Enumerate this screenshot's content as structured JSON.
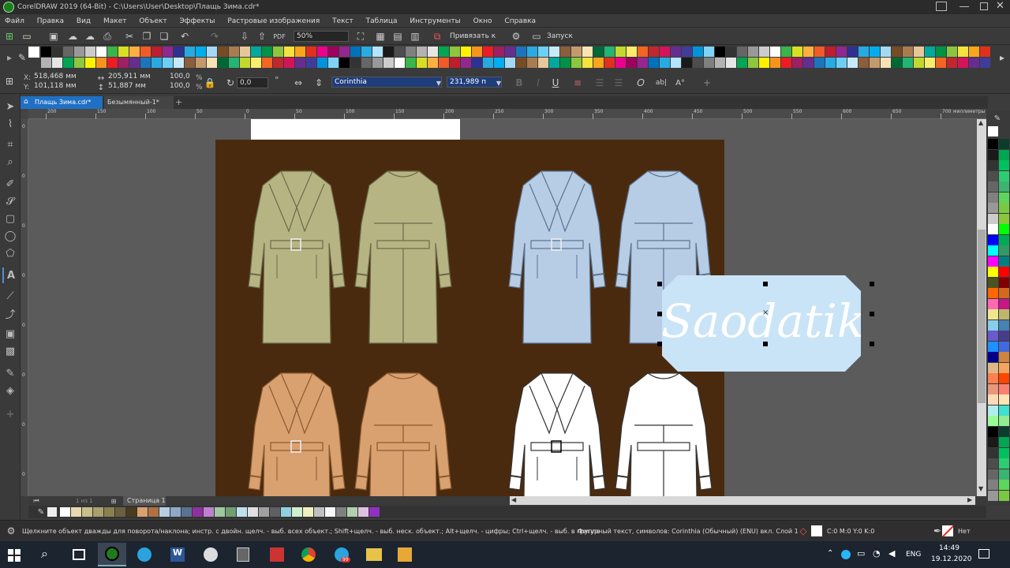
{
  "window": {
    "title": "CorelDRAW 2019 (64-Bit) - C:\\Users\\User\\Desktop\\Плащь Зима.cdr*"
  },
  "menu": [
    "Файл",
    "Правка",
    "Вид",
    "Макет",
    "Объект",
    "Эффекты",
    "Растровые изображения",
    "Текст",
    "Таблица",
    "Инструменты",
    "Окно",
    "Справка"
  ],
  "toolbar": {
    "zoom": "50%",
    "snap_label": "Привязать к",
    "launch_label": "Запуск"
  },
  "props": {
    "x_label": "X:",
    "x": "518,468 мм",
    "y_label": "Y:",
    "y": "101,118 мм",
    "w": "205,911 мм",
    "h": "51,887 мм",
    "scale_w": "100,0",
    "scale_h": "100,0",
    "pct": "%",
    "angle": "0,0",
    "deg": "°",
    "font": "Corinthia",
    "font_size": "231,989 п"
  },
  "tabs": [
    {
      "label": "Плащь Зима.cdr*",
      "active": true
    },
    {
      "label": "Безымянный-1*",
      "active": false
    }
  ],
  "ruler": {
    "ticks": [
      "200",
      "150",
      "100",
      "50",
      "0",
      "50",
      "100",
      "150",
      "200",
      "250",
      "300",
      "350",
      "400",
      "450",
      "500",
      "550",
      "600",
      "650",
      "700"
    ],
    "unit": "миллиметры"
  },
  "vruler": {
    "ticks": [
      "0",
      "0",
      "0",
      "0",
      "0",
      "0",
      "0",
      "0"
    ]
  },
  "canvas": {
    "artboard_color": "#4a2a0e",
    "selected_text": "Saodatik",
    "label_color": "#c9e4f7",
    "coats": [
      {
        "fill": "#b7b484",
        "stroke": "#6a6a48",
        "view": "front"
      },
      {
        "fill": "#b7b484",
        "stroke": "#6a6a48",
        "view": "back"
      },
      {
        "fill": "#b7cde6",
        "stroke": "#5b7290",
        "view": "front"
      },
      {
        "fill": "#b7cde6",
        "stroke": "#5b7290",
        "view": "back"
      },
      {
        "fill": "#d9a070",
        "stroke": "#8a5a30",
        "view": "front"
      },
      {
        "fill": "#d9a070",
        "stroke": "#8a5a30",
        "view": "back"
      },
      {
        "fill": "#ffffff",
        "stroke": "#333333",
        "view": "front"
      },
      {
        "fill": "#ffffff",
        "stroke": "#333333",
        "view": "back"
      }
    ]
  },
  "page_nav": {
    "counter": "1 из 1",
    "page_tab": "Страница 1"
  },
  "status": {
    "hint": "Щелкните объект дважды для поворота/наклона; инстр. с двойн. щелч. - выб. всех объект.; Shift+щелч. - выб. неск. объект.; Alt+щелч. - цифры; Ctrl+щелч. - выб. в группе",
    "info": "Фигурный текст, символов: Corinthia (Обычный) (ENU) вкл. Слой 1",
    "fill_info": "C:0 M:0 Y:0 K:0",
    "outline_label": "Нет"
  },
  "taskbar": {
    "lang": "ENG",
    "time": "14:49",
    "date": "19.12.2020",
    "badge": "99"
  },
  "palette_colors": [
    "#000000",
    "#1a1a1a",
    "#333333",
    "#4d4d4d",
    "#666666",
    "#808080",
    "#999999",
    "#b3b3b3",
    "#cccccc",
    "#e6e6e6",
    "#ffffff",
    "#00a651",
    "#39b54a",
    "#8dc63f",
    "#d7df23",
    "#fff200",
    "#fbb040",
    "#f7941d",
    "#f15a29",
    "#ed1c24",
    "#be1e2d",
    "#9e1f63",
    "#92278f",
    "#662d91",
    "#2e3192",
    "#1c75bc",
    "#27aae1",
    "#29abe2",
    "#00aeef",
    "#6dcff6",
    "#a3d9f5",
    "#c7eafb",
    "#754c24",
    "#8b5e3c",
    "#a97c50",
    "#c49a6c",
    "#e6c79a",
    "#f9e3b4",
    "#00a99d",
    "#006837",
    "#009245",
    "#22b573",
    "#8cc63f",
    "#c2d82e",
    "#f4e23f",
    "#f9ed6b",
    "#faa61a",
    "#f26522",
    "#e0301e",
    "#c1272d",
    "#ec008c",
    "#d4145a",
    "#9e005d",
    "#662d91",
    "#93278f",
    "#3f3d99",
    "#0071bc",
    "#0093dd",
    "#29abe2",
    "#7fd3f7",
    "#b3e5fc"
  ],
  "right_palette": [
    "#000000",
    "#0b3d2e",
    "#1a1a1a",
    "#00a651",
    "#333333",
    "#00c060",
    "#4d4d4d",
    "#2ecc71",
    "#666666",
    "#3cb371",
    "#808080",
    "#5cd65c",
    "#999999",
    "#7ac943",
    "#cccccc",
    "#8cc63f",
    "#ffffff",
    "#00ff00",
    "#0000ff",
    "#00aa55",
    "#00ffff",
    "#339966",
    "#ff00ff",
    "#008080",
    "#ffff00",
    "#ff0000",
    "#4b5320",
    "#800000",
    "#ff6600",
    "#d2691e",
    "#ff69b4",
    "#c71585",
    "#f0e68c",
    "#bdb76b",
    "#87ceeb",
    "#4682b4",
    "#6a5acd",
    "#483d8b",
    "#1e90ff",
    "#4169e1",
    "#00008b",
    "#cd853f",
    "#deb887",
    "#f4a460",
    "#ff7f50",
    "#ff4500",
    "#e9967a",
    "#fa8072",
    "#ffdab9",
    "#ffe4b5",
    "#afeeee",
    "#40e0d0",
    "#98fb98",
    "#90ee90"
  ],
  "doc_palette": [
    "#ffffff",
    "#e8d8b0",
    "#c8c088",
    "#a8a070",
    "#8a8050",
    "#6a6040",
    "#4a3a20",
    "#d9a070",
    "#b07040",
    "#b7cde6",
    "#8fa8c8",
    "#5b7290",
    "#9030a0",
    "#c080d0",
    "#a0c8a0",
    "#70a070",
    "#c0e0f0",
    "#e0e0e0",
    "#a0a0a0",
    "#606060",
    "#90d0e0",
    "#d0f0d0",
    "#f0f0c0",
    "#c0c0c0",
    "#f8f8f8",
    "#808080",
    "#b0d0b0",
    "#e0c0e0",
    "#9030c0"
  ]
}
